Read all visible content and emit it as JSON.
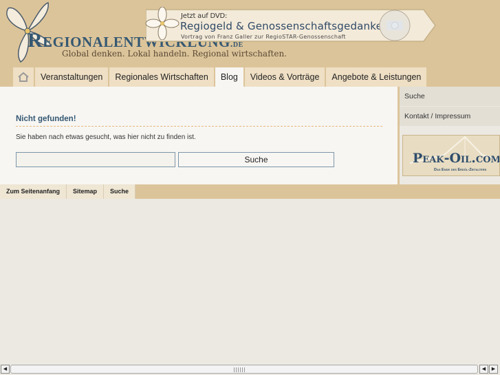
{
  "logo": {
    "name": "Regionalentwicklung",
    "tld": ".de",
    "tagline": "Global denken. Lokal handeln. Regional wirtschaften."
  },
  "dvd_banner": {
    "kicker": "Jetzt auf DVD:",
    "title": "Regiogeld & Genossenschaftsgedanke",
    "subtitle": "Vortrag von Franz Galler zur RegioSTAR-Genossenschaft"
  },
  "nav": {
    "home_icon": "home-icon",
    "items": [
      {
        "label": "Veranstaltungen"
      },
      {
        "label": "Regionales Wirtschaften"
      },
      {
        "label": "Blog"
      },
      {
        "label": "Videos & Vorträge"
      },
      {
        "label": "Angebote & Leistungen"
      }
    ],
    "active": "Blog"
  },
  "content": {
    "title": "Nicht gefunden!",
    "text": "Sie haben nach etwas gesucht, was hier nicht zu finden ist.",
    "search_value": "",
    "search_button": "Suche"
  },
  "sidebar": {
    "items": [
      {
        "label": "Suche"
      },
      {
        "label": "Kontakt / Impressum"
      }
    ],
    "banner": {
      "title": "Peak-Oil.com",
      "subtitle": "Das Ende des Erdöl-Zeitalters"
    }
  },
  "footer": {
    "links": [
      {
        "label": "Zum Seitenanfang"
      },
      {
        "label": "Sitemap"
      },
      {
        "label": "Suche"
      }
    ]
  },
  "colors": {
    "header_bg": "#dcc49a",
    "nav_tab_bg": "#efdfc4",
    "accent_blue": "#355872",
    "page_bg": "#ece9e2"
  }
}
